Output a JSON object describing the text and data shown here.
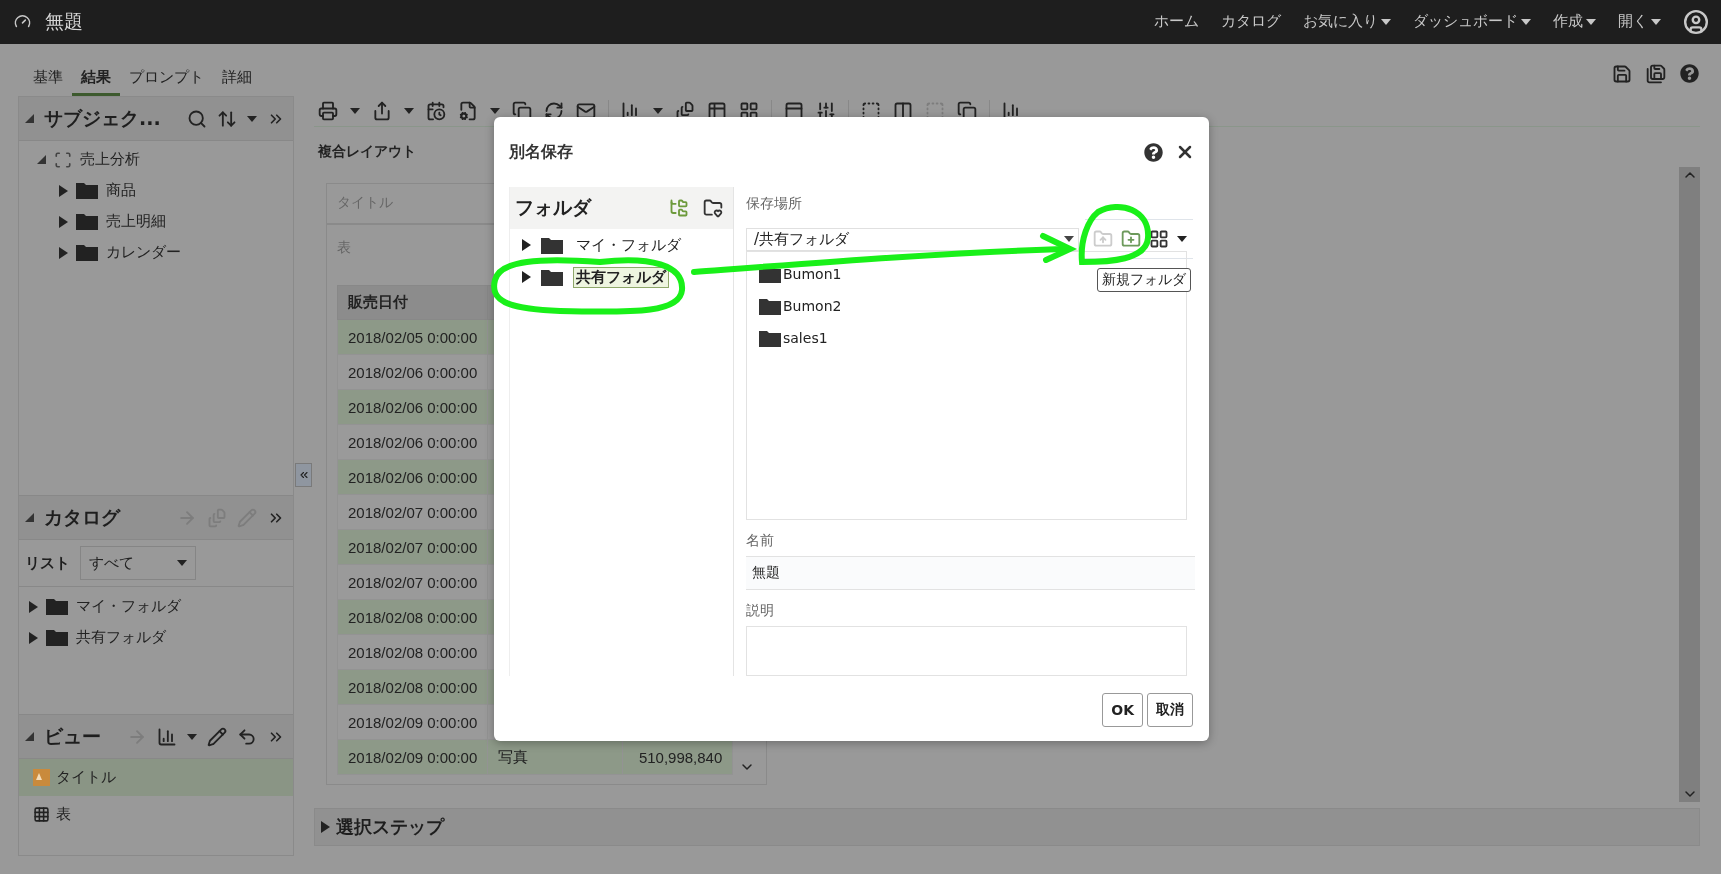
{
  "app_bar": {
    "title": "無題",
    "nav": [
      {
        "label": "ホーム",
        "menu": false
      },
      {
        "label": "カタログ",
        "menu": false
      },
      {
        "label": "お気に入り",
        "menu": true
      },
      {
        "label": "ダッシュボード",
        "menu": true
      },
      {
        "label": "作成",
        "menu": true
      },
      {
        "label": "開く",
        "menu": true
      }
    ]
  },
  "tabs": [
    {
      "label": "基準",
      "selected": false
    },
    {
      "label": "結果",
      "selected": true
    },
    {
      "label": "プロンプト",
      "selected": false
    },
    {
      "label": "詳細",
      "selected": false
    }
  ],
  "subject_areas": {
    "title": "サブジェク...",
    "root": {
      "label": "売上分析",
      "expanded": true,
      "children": [
        {
          "label": "商品",
          "expanded": false
        },
        {
          "label": "売上明細",
          "expanded": false
        },
        {
          "label": "カレンダー",
          "expanded": false
        }
      ]
    }
  },
  "catalog": {
    "title": "カタログ",
    "list_label": "リスト",
    "list_value": "すべて",
    "items": [
      {
        "label": "マイ・フォルダ",
        "expanded": false
      },
      {
        "label": "共有フォルダ",
        "expanded": false
      }
    ]
  },
  "views": {
    "title": "ビュー",
    "items": [
      {
        "label": "タイトル",
        "kind": "title",
        "selected": true
      },
      {
        "label": "表",
        "kind": "table",
        "selected": false
      }
    ]
  },
  "layout": {
    "heading": "複合レイアウト",
    "title_view": "タイトル",
    "table_view": {
      "label": "表",
      "columns": [
        "販売日付"
      ],
      "rows": [
        {
          "cells": [
            "2018/02/05 0:00:00"
          ]
        },
        {
          "cells": [
            "2018/02/06 0:00:00"
          ]
        },
        {
          "cells": [
            "2018/02/06 0:00:00"
          ]
        },
        {
          "cells": [
            "2018/02/06 0:00:00"
          ]
        },
        {
          "cells": [
            "2018/02/06 0:00:00"
          ]
        },
        {
          "cells": [
            "2018/02/07 0:00:00"
          ]
        },
        {
          "cells": [
            "2018/02/07 0:00:00"
          ]
        },
        {
          "cells": [
            "2018/02/07 0:00:00"
          ]
        },
        {
          "cells": [
            "2018/02/08 0:00:00"
          ]
        },
        {
          "cells": [
            "2018/02/08 0:00:00"
          ]
        },
        {
          "cells": [
            "2018/02/08 0:00:00"
          ]
        },
        {
          "cells": [
            "2018/02/09 0:00:00"
          ]
        },
        {
          "cells": [
            "2018/02/09 0:00:00",
            "写真",
            "510,998,840"
          ]
        }
      ]
    }
  },
  "selection_steps": {
    "label": "選択ステップ",
    "expanded": false
  },
  "dialog": {
    "title": "別名保存",
    "folders": {
      "title": "フォルダ",
      "items": [
        {
          "label": "マイ・フォルダ",
          "selected": false
        },
        {
          "label": "共有フォルダ",
          "selected": true
        }
      ]
    },
    "location_label": "保存場所",
    "location": "/共有フォルダ",
    "contents": [
      "Bumon1",
      "Bumon2",
      "sales1"
    ],
    "tooltip": "新規フォルダ",
    "name_label": "名前",
    "name": "無題",
    "description_label": "説明",
    "buttons": [
      "OK",
      "取消"
    ]
  }
}
